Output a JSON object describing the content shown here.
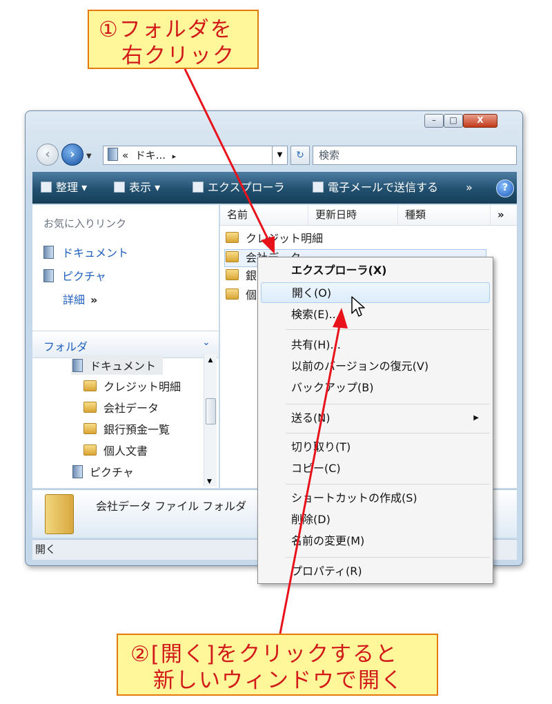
{
  "callouts": {
    "first_line1": "①フォルダを",
    "first_line2": "　右クリック",
    "second_line1": "②[開く]をクリックすると",
    "second_line2": "　新しいウィンドウで開く"
  },
  "window": {
    "caption_buttons": {
      "minimize": "–",
      "maximize": "□",
      "close": "X"
    },
    "address": {
      "prefix": "«",
      "path": "ドキ...",
      "separator": "▸"
    },
    "search_placeholder": "検索"
  },
  "toolbar": {
    "organize": "整理 ▾",
    "views": "表示 ▾",
    "explorer": "エクスプローラ",
    "email": "電子メールで送信する",
    "more": "»",
    "help": "?"
  },
  "nav_pane": {
    "favorites_header": "お気に入りリンク",
    "links": [
      "ドキュメント",
      "ピクチャ"
    ],
    "more_label": "詳細",
    "more_chevrons": "»",
    "folders_header": "フォルダ",
    "tree": [
      "ドキュメント",
      "クレジット明細",
      "会社データ",
      "銀行預金一覧",
      "個人文書",
      "ピクチャ"
    ]
  },
  "file_list": {
    "columns": [
      "名前",
      "更新日時",
      "種類"
    ],
    "more": "»",
    "rows": [
      "クレジット明細",
      "会社データ",
      "銀",
      "個"
    ]
  },
  "details": {
    "text": "会社データ ファイル フォルダ"
  },
  "status_bar": "開く",
  "context_menu": {
    "items": {
      "explorer": "エクスプローラ(X)",
      "open": "開く(O)",
      "search": "検索(E)...",
      "share": "共有(H)...",
      "restore": "以前のバージョンの復元(V)",
      "backup": "バックアップ(B)",
      "send_to": "送る(N)",
      "cut": "切り取り(T)",
      "copy": "コピー(C)",
      "shortcut": "ショートカットの作成(S)",
      "delete": "削除(D)",
      "rename": "名前の変更(M)",
      "properties": "プロパティ(R)"
    }
  },
  "colors": {
    "arrow": "#e8121b",
    "callout_bg": "#fff799",
    "callout_border": "#e37a0b",
    "toolbar": "#21506f"
  }
}
